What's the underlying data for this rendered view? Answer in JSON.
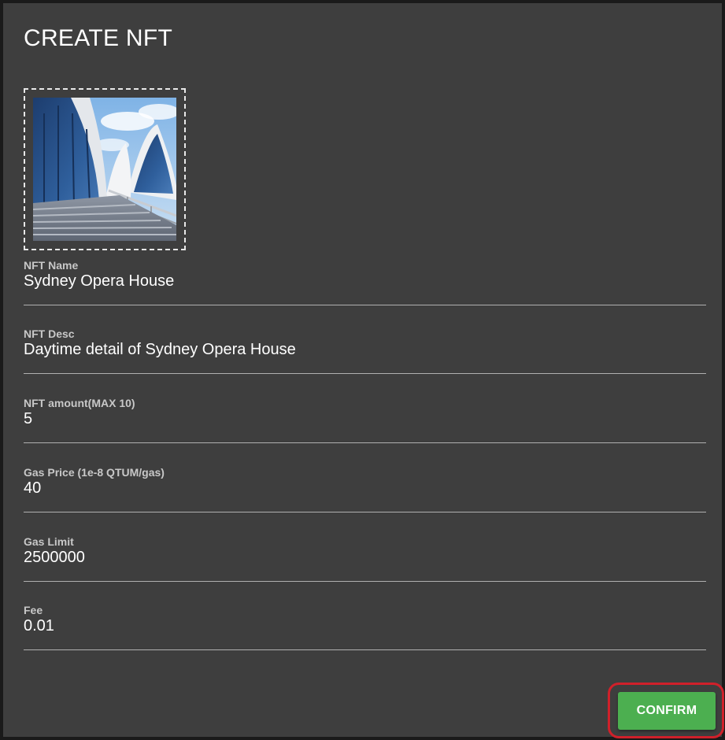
{
  "dialog": {
    "title": "CREATE NFT",
    "image_alt": "Sydney Opera House daytime photo"
  },
  "fields": [
    {
      "label": "NFT Name",
      "value": "Sydney Opera House"
    },
    {
      "label": "NFT Desc",
      "value": "Daytime detail of Sydney Opera House"
    },
    {
      "label": "NFT amount(MAX 10)",
      "value": "5"
    },
    {
      "label": "Gas Price (1e-8 QTUM/gas)",
      "value": "40"
    },
    {
      "label": "Gas Limit",
      "value": "2500000"
    },
    {
      "label": "Fee",
      "value": "0.01"
    }
  ],
  "actions": {
    "confirm_label": "CONFIRM"
  },
  "colors": {
    "dialog_background": "#3e3e3e",
    "confirm_button": "#4caf50",
    "highlight": "#d0202a"
  }
}
